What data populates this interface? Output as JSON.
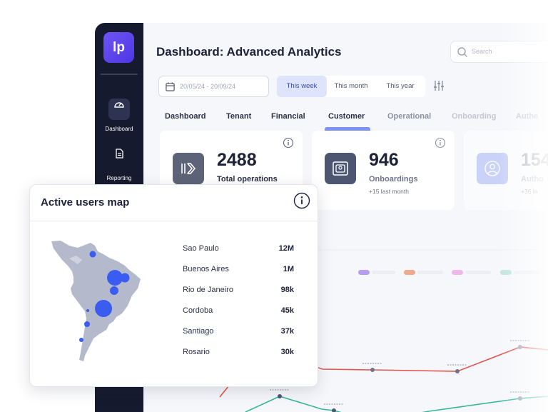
{
  "sidebar": {
    "logo": "lp",
    "items": [
      {
        "label": "Dashboard",
        "icon": "gauge-icon"
      },
      {
        "label": "Reporting",
        "icon": "document-icon"
      }
    ]
  },
  "header": {
    "title": "Dashboard: Advanced Analytics",
    "search_placeholder": "Search"
  },
  "filters": {
    "date_range": "20/05/24 - 20/09/24",
    "periods": [
      "This week",
      "This month",
      "This year"
    ],
    "selected_period": "This week"
  },
  "tabs": [
    "Dashboard",
    "Tenant",
    "Financial",
    "Customer",
    "Operational",
    "Onboarding",
    "Authe"
  ],
  "active_tab": "Customer",
  "cards": [
    {
      "value": "2488",
      "label": "Total operations",
      "sub": "",
      "icon": "arrow-right-icon"
    },
    {
      "value": "946",
      "label": "Onboardings",
      "sub": "+15 last month",
      "icon": "id-card-icon"
    },
    {
      "value": "154",
      "label": "Autho",
      "sub": "+36 la",
      "icon": "user-icon"
    }
  ],
  "popup": {
    "title": "Active users map",
    "cities": [
      {
        "name": "Sao Paulo",
        "value": "12M"
      },
      {
        "name": "Buenos Aires",
        "value": "1M"
      },
      {
        "name": "Rio de Janeiro",
        "value": "98k"
      },
      {
        "name": "Cordoba",
        "value": "45k"
      },
      {
        "name": "Santiago",
        "value": "37k"
      },
      {
        "name": "Rosario",
        "value": "30k"
      }
    ]
  },
  "colors": {
    "accent": "#3b4aa8",
    "bubble": "#3a5cf0",
    "sidebar": "#161a2e",
    "line_red": "#e0574f",
    "line_teal": "#36b59a"
  }
}
